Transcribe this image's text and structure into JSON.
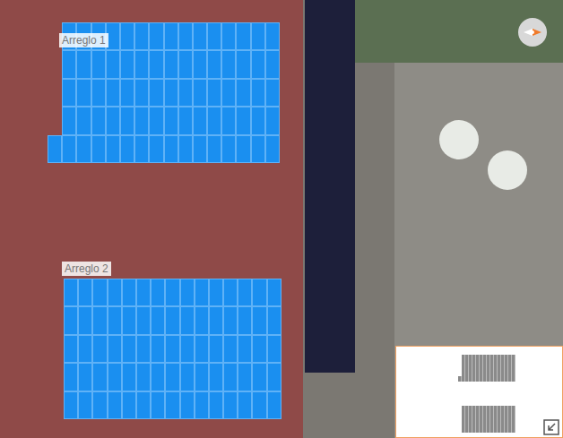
{
  "map": {
    "compass": true
  },
  "arrays": [
    {
      "label": "Arreglo 1",
      "rows": [
        15,
        15,
        15,
        15,
        16
      ]
    },
    {
      "label": "Arreglo 2",
      "rows": [
        15,
        15,
        15,
        15,
        15
      ]
    }
  ],
  "minimap": {
    "expandable": true
  }
}
